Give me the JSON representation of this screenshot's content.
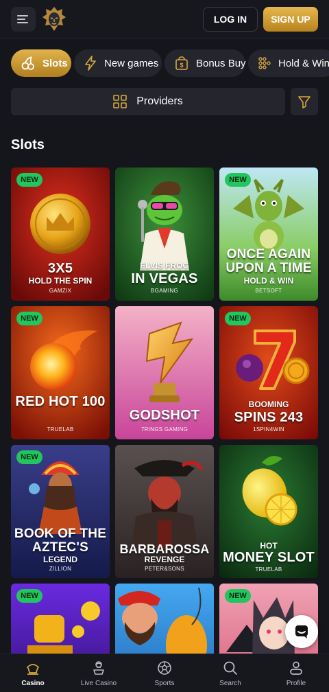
{
  "header": {
    "login_label": "LOG IN",
    "signup_label": "SIGN UP"
  },
  "categories": [
    {
      "label": "Slots",
      "icon": "cherries-icon",
      "active": true
    },
    {
      "label": "New games",
      "icon": "lightning-icon",
      "active": false
    },
    {
      "label": "Bonus Buy",
      "icon": "bonus-bag-icon",
      "active": false
    },
    {
      "label": "Hold & Win",
      "icon": "dots-grid-icon",
      "active": false
    }
  ],
  "providers": {
    "label": "Providers"
  },
  "section": {
    "title": "Slots"
  },
  "games": [
    {
      "title": "3X5",
      "subtitle": "HOLD THE SPIN",
      "provider": "GAMZIX",
      "is_new": true,
      "badge": "NEW"
    },
    {
      "title": "IN VEGAS",
      "subtitle": "ELVIS FROG",
      "provider": "BGAMING",
      "is_new": false,
      "badge": ""
    },
    {
      "title": "ONCE AGAIN UPON A TIME",
      "subtitle": "HOLD & WIN",
      "provider": "BETSOFT",
      "is_new": true,
      "badge": "NEW"
    },
    {
      "title": "RED HOT 100",
      "subtitle": "",
      "provider": "TRUELAB",
      "is_new": true,
      "badge": "NEW"
    },
    {
      "title": "GODSHOT",
      "subtitle": "",
      "provider": "7RINGS GAMING",
      "is_new": false,
      "badge": ""
    },
    {
      "title": "SPINS 243",
      "subtitle": "BOOMING",
      "provider": "1SPIN4WIN",
      "is_new": true,
      "badge": "NEW"
    },
    {
      "title": "BOOK OF THE AZTEC'S",
      "subtitle": "LEGEND",
      "provider": "ZILLION",
      "is_new": true,
      "badge": "NEW"
    },
    {
      "title": "BARBAROSSA",
      "subtitle": "REVENGE",
      "provider": "PETER&SONS",
      "is_new": false,
      "badge": ""
    },
    {
      "title": "MONEY SLOT",
      "subtitle": "HOT",
      "provider": "TRUELAB",
      "is_new": false,
      "badge": ""
    },
    {
      "title": "",
      "subtitle": "",
      "provider": "",
      "is_new": true,
      "badge": "NEW"
    },
    {
      "title": "",
      "subtitle": "",
      "provider": "",
      "is_new": false,
      "badge": ""
    },
    {
      "title": "",
      "subtitle": "",
      "provider": "",
      "is_new": true,
      "badge": "NEW"
    }
  ],
  "bottom_nav": [
    {
      "label": "Casino",
      "icon": "casino-icon",
      "active": true
    },
    {
      "label": "Live Casino",
      "icon": "live-casino-icon",
      "active": false
    },
    {
      "label": "Sports",
      "icon": "soccer-ball-icon",
      "active": false
    },
    {
      "label": "Search",
      "icon": "search-icon",
      "active": false
    },
    {
      "label": "Profile",
      "icon": "profile-icon",
      "active": false
    }
  ],
  "colors": {
    "background": "#15161c",
    "surface": "#24252d",
    "gold": "#d8a93f",
    "new_badge": "#22c55e"
  }
}
